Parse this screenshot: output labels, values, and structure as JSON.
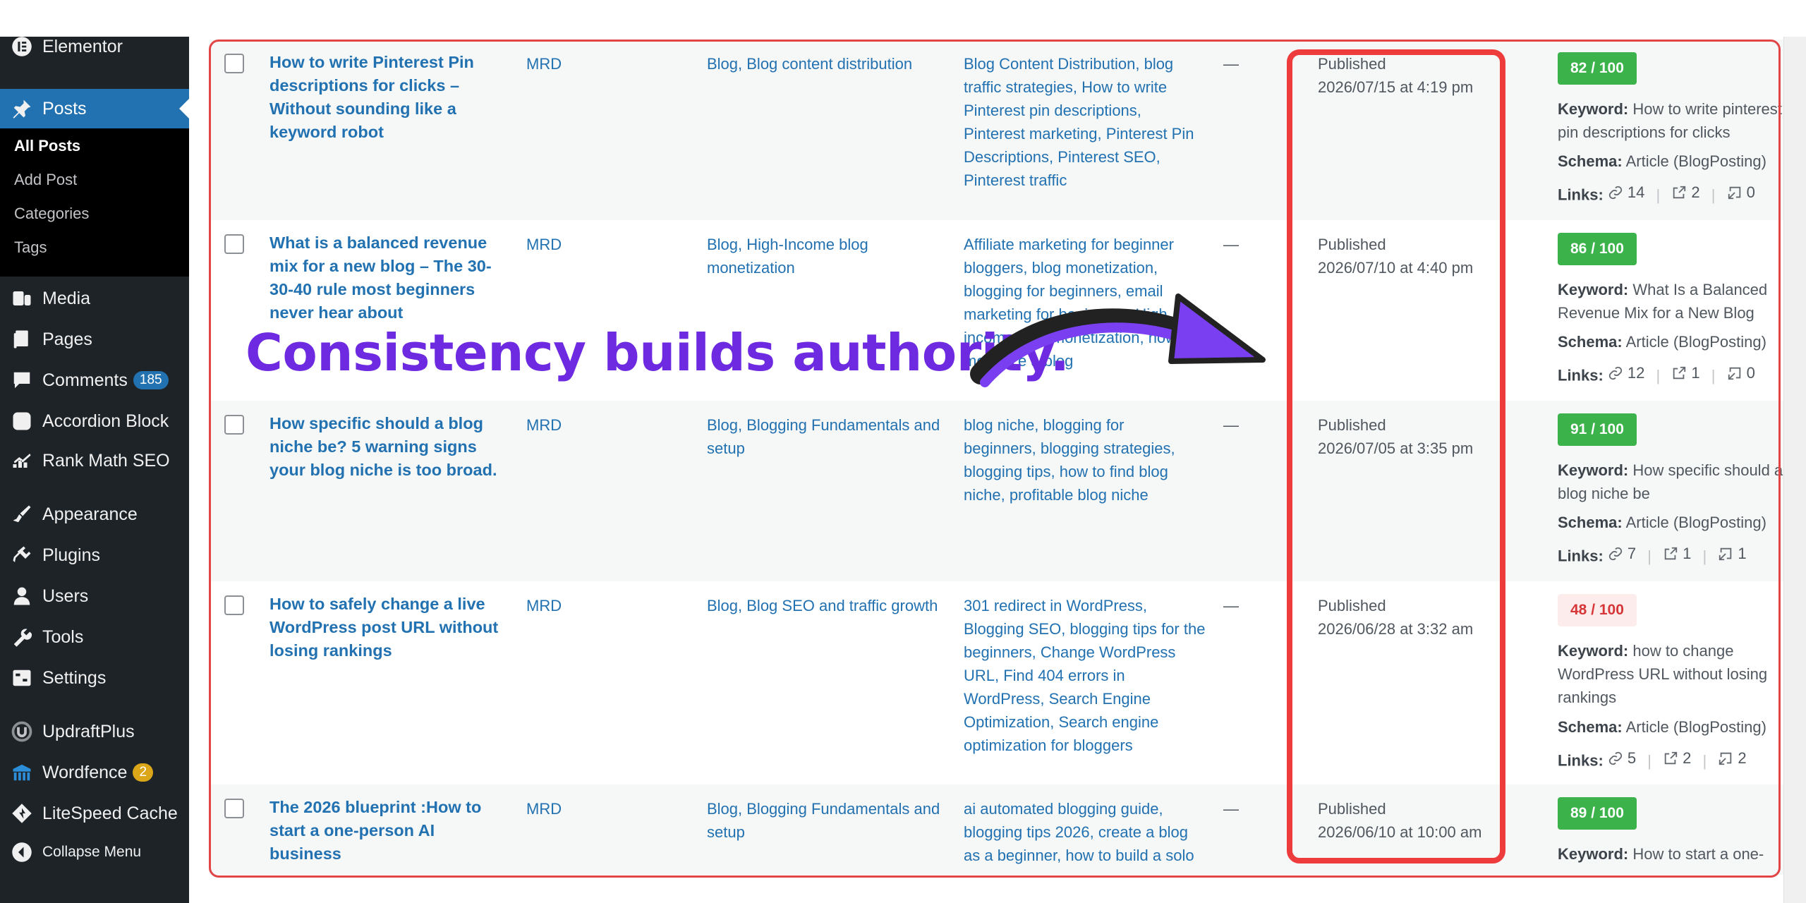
{
  "sidebar": {
    "top_item": {
      "label": "Elementor",
      "icon": "elementor-icon"
    },
    "posts": {
      "label": "Posts",
      "icon": "pin-icon"
    },
    "submenu": [
      "All Posts",
      "Add Post",
      "Categories",
      "Tags"
    ],
    "items": [
      {
        "label": "Media",
        "icon": "media-icon"
      },
      {
        "label": "Pages",
        "icon": "pages-icon"
      },
      {
        "label": "Comments",
        "icon": "comments-icon",
        "badge": "185"
      },
      {
        "label": "Accordion Block",
        "icon": "accordion-icon"
      },
      {
        "label": "Rank Math SEO",
        "icon": "rank-math-icon"
      },
      {
        "label": "Appearance",
        "icon": "appearance-icon"
      },
      {
        "label": "Plugins",
        "icon": "plugins-icon"
      },
      {
        "label": "Users",
        "icon": "users-icon"
      },
      {
        "label": "Tools",
        "icon": "tools-icon"
      },
      {
        "label": "Settings",
        "icon": "settings-icon"
      },
      {
        "label": "UpdraftPlus",
        "icon": "updraftplus-icon"
      },
      {
        "label": "Wordfence",
        "icon": "wordfence-icon",
        "badge": "2"
      },
      {
        "label": "LiteSpeed Cache",
        "icon": "litespeed-icon"
      },
      {
        "label": "Collapse Menu",
        "icon": "collapse-icon"
      }
    ]
  },
  "labels": {
    "keyword": "Keyword:",
    "schema": "Schema:",
    "links": "Links:"
  },
  "rows": [
    {
      "title": "How to write Pinterest Pin descriptions for clicks – Without sounding like a keyword robot",
      "author": "MRD",
      "categories": "Blog, Blog content distribution",
      "tags": "Blog Content Distribution, blog traffic strategies, How to write Pinterest pin descriptions, Pinterest marketing, Pinterest Pin Descriptions, Pinterest SEO, Pinterest traffic",
      "comments": "—",
      "status": "Published",
      "date": "2026/07/15 at 4:19 pm",
      "score": "82 / 100",
      "keyword": "How to write pinterest pin descriptions for clicks",
      "schema": "Article (BlogPosting)",
      "links_internal": "14",
      "links_external": "2",
      "links_incoming": "0"
    },
    {
      "title": "What is a balanced revenue mix for a new blog – The 30-30-40 rule most beginners never hear about",
      "author": "MRD",
      "categories": "Blog, High-Income blog monetization",
      "tags": "Affiliate marketing for beginner bloggers, blog monetization, blogging for beginners, email marketing for beginners, High income blog monetization, how to monetize a blog",
      "comments": "—",
      "status": "Published",
      "date": "2026/07/10 at 4:40 pm",
      "score": "86 / 100",
      "keyword": "What Is a Balanced Revenue Mix for a New Blog",
      "schema": "Article (BlogPosting)",
      "links_internal": "12",
      "links_external": "1",
      "links_incoming": "0"
    },
    {
      "title": "How specific should a blog niche be? 5 warning signs your blog niche is too broad.",
      "author": "MRD",
      "categories": "Blog, Blogging Fundamentals and setup",
      "tags": "blog niche, blogging for beginners, blogging strategies, blogging tips, how to find blog niche, profitable blog niche",
      "comments": "—",
      "status": "Published",
      "date": "2026/07/05 at 3:35 pm",
      "score": "91 / 100",
      "keyword": "How specific should a blog niche be",
      "schema": "Article (BlogPosting)",
      "links_internal": "7",
      "links_external": "1",
      "links_incoming": "1"
    },
    {
      "title": "How to safely change a live WordPress post URL without losing rankings",
      "author": "MRD",
      "categories": "Blog, Blog SEO and traffic growth",
      "tags": "301 redirect in WordPress, Blogging SEO, blogging tips for the beginners, Change WordPress URL, Find 404 errors in WordPress, Search Engine Optimization, Search engine optimization for bloggers",
      "comments": "—",
      "status": "Published",
      "date": "2026/06/28 at 3:32 am",
      "score": "48 / 100",
      "keyword": "how to change WordPress URL without losing rankings",
      "schema": "Article (BlogPosting)",
      "links_internal": "5",
      "links_external": "2",
      "links_incoming": "2"
    },
    {
      "title": "The 2026 blueprint :How to start a one-person AI business",
      "author": "MRD",
      "categories": "Blog, Blogging Fundamentals and setup",
      "tags": "ai automated blogging guide, blogging tips 2026, create a blog as a beginner, how to build a solo",
      "comments": "—",
      "status": "Published",
      "date": "2026/06/10 at 10:00 am",
      "score": "89 / 100",
      "keyword": "How to start a one-",
      "schema": "",
      "links_internal": "",
      "links_external": "",
      "links_incoming": ""
    }
  ],
  "overlay": {
    "headline": "Consistency builds authority."
  },
  "colors": {
    "accent": "#2271b1",
    "headline": "#6d2ae0",
    "outline": "#ee3b3b",
    "score_good": "#3cb34a",
    "score_bad": "#d63638"
  }
}
